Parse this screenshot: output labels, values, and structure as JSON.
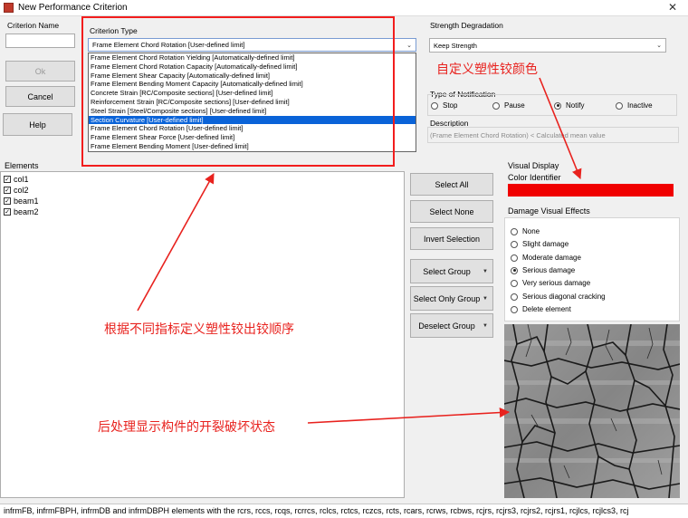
{
  "window": {
    "title": "New Performance Criterion",
    "close_glyph": "✕"
  },
  "criterion_name": {
    "label": "Criterion Name",
    "value": ""
  },
  "buttons": {
    "ok": "Ok",
    "cancel": "Cancel",
    "help": "Help"
  },
  "criterion_type": {
    "label": "Criterion Type",
    "selected": "Frame Element Chord Rotation [User-defined limit]",
    "options": [
      "Frame Element Chord Rotation Yielding [Automatically-defined limit]",
      "Frame Element Chord Rotation Capacity [Automatically-defined limit]",
      "Frame Element Shear Capacity [Automatically-defined limit]",
      "Frame Element Bending Moment Capacity [Automatically-defined limit]",
      "Concrete Strain [RC/Composite sections] [User-defined limit]",
      "Reinforcement Strain [RC/Composite sections] [User-defined limit]",
      "Steel Strain [Steel/Composite sections] [User-defined limit]",
      "Section Curvature [User-defined limit]",
      "Frame Element Chord Rotation [User-defined limit]",
      "Frame Element Shear Force [User-defined limit]",
      "Frame Element Bending Moment [User-defined limit]"
    ],
    "highlighted_index": 7
  },
  "strength_degradation": {
    "label": "Strength Degradation",
    "value": "Keep Strength"
  },
  "notification": {
    "label": "Type of Notification",
    "options": [
      "Stop",
      "Pause",
      "Notify",
      "Inactive"
    ],
    "selected": "Notify"
  },
  "description": {
    "label": "Description",
    "value": "(Frame Element Chord Rotation) < Calculated mean value"
  },
  "elements": {
    "label": "Elements",
    "items": [
      {
        "name": "col1",
        "checked": true
      },
      {
        "name": "col2",
        "checked": true
      },
      {
        "name": "beam1",
        "checked": true
      },
      {
        "name": "beam2",
        "checked": true
      }
    ]
  },
  "selection_buttons": {
    "select_all": "Select All",
    "select_none": "Select None",
    "invert_selection": "Invert Selection",
    "select_group": "Select Group",
    "select_only_group": "Select Only Group",
    "deselect_group": "Deselect Group"
  },
  "visual_display": {
    "label": "Visual Display",
    "color_identifier_label": "Color Identifier",
    "color": "#f00000"
  },
  "damage_visual_effects": {
    "label": "Damage Visual Effects",
    "options": [
      "None",
      "Slight damage",
      "Moderate damage",
      "Serious damage",
      "Very serious damage",
      "Serious diagonal cracking",
      "Delete element"
    ],
    "selected": "Serious damage"
  },
  "annotations": {
    "color_note": "自定义塑性铰颜色",
    "order_note": "根据不同指标定义塑性铰出铰顺序",
    "damage_note": "后处理显示构件的开裂破坏状态"
  },
  "status_bar": "infrmFB, infrmFBPH, infrmDB and infrmDBPH elements with the rcrs, rccs, rcqs, rcrrcs, rclcs, rctcs, rczcs, rcts, rcars, rcrws, rcbws, rcjrs, rcjrs3, rcjrs2, rcjrs1, rcjlcs, rcjlcs3, rcj"
}
